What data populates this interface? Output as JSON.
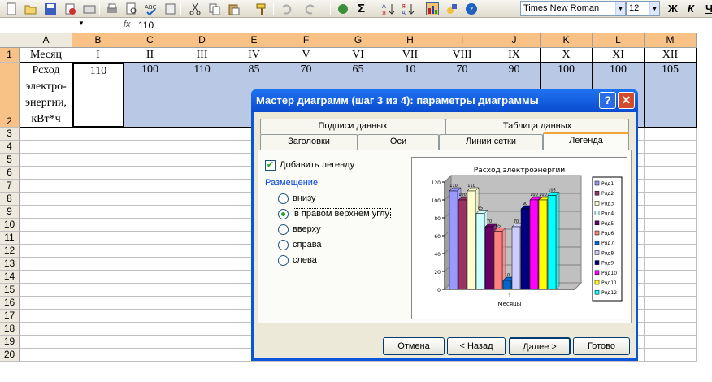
{
  "toolbar": {
    "font": "Times New Roman",
    "size": "12",
    "bold": "Ж",
    "italic": "К",
    "underline": "Ч"
  },
  "formula": {
    "ref": "",
    "fx": "fx",
    "value": "110"
  },
  "columns": [
    "A",
    "B",
    "C",
    "D",
    "E",
    "F",
    "G",
    "H",
    "I",
    "J",
    "K",
    "L",
    "M"
  ],
  "rows": [
    "1",
    "2",
    "3",
    "4",
    "5",
    "6",
    "7",
    "8",
    "9",
    "10",
    "11",
    "12",
    "13",
    "14",
    "15",
    "16",
    "17",
    "18",
    "19",
    "20"
  ],
  "row1": [
    "Месяц",
    "I",
    "II",
    "III",
    "IV",
    "V",
    "VI",
    "VII",
    "VIII",
    "IX",
    "X",
    "XI",
    "XII"
  ],
  "row2_label": [
    "Рсход",
    "электро-",
    "энергии,",
    "кВт*ч"
  ],
  "row2": [
    "110",
    "100",
    "110",
    "85",
    "70",
    "65",
    "10",
    "70",
    "90",
    "100",
    "100",
    "105"
  ],
  "dialog": {
    "title": "Мастер диаграмм (шаг 3 из 4): параметры диаграммы",
    "help": "?",
    "close": "✕",
    "tabs_back": [
      "Подписи данных",
      "Таблица данных"
    ],
    "tabs_front": [
      "Заголовки",
      "Оси",
      "Линии сетки",
      "Легенда"
    ],
    "add_legend": "Добавить легенду",
    "placement": "Размещение",
    "options": [
      "внизу",
      "в правом верхнем углу",
      "вверху",
      "справа",
      "слева"
    ],
    "buttons": [
      "Отмена",
      "< Назад",
      "Далее >",
      "Готово"
    ]
  },
  "chart_data": {
    "type": "bar",
    "title": "Расход электроэнергии",
    "xlabel": "Месяцы",
    "categories": [
      "1"
    ],
    "ylim": [
      0,
      120
    ],
    "yticks": [
      "0",
      "20",
      "40",
      "60",
      "80",
      "100",
      "120"
    ],
    "series": [
      {
        "name": "Ряд1",
        "values": [
          110
        ],
        "color": "#9999ff"
      },
      {
        "name": "Ряд2",
        "values": [
          100
        ],
        "color": "#993366"
      },
      {
        "name": "Ряд3",
        "values": [
          110
        ],
        "color": "#ffffcc"
      },
      {
        "name": "Ряд4",
        "values": [
          85
        ],
        "color": "#ccffff"
      },
      {
        "name": "Ряд5",
        "values": [
          70
        ],
        "color": "#660066"
      },
      {
        "name": "Ряд6",
        "values": [
          65
        ],
        "color": "#ff8080"
      },
      {
        "name": "Ряд7",
        "values": [
          10
        ],
        "color": "#0066cc"
      },
      {
        "name": "Ряд8",
        "values": [
          70
        ],
        "color": "#ccccff"
      },
      {
        "name": "Ряд9",
        "values": [
          90
        ],
        "color": "#000080"
      },
      {
        "name": "Ряд10",
        "values": [
          100
        ],
        "color": "#ff00ff"
      },
      {
        "name": "Ряд11",
        "values": [
          100
        ],
        "color": "#ffff00"
      },
      {
        "name": "Ряд12",
        "values": [
          105
        ],
        "color": "#00ffff"
      }
    ],
    "data_labels": [
      "110",
      "100",
      "110",
      "85",
      "70",
      "65",
      "10",
      "70",
      "90",
      "100",
      "100",
      "105"
    ],
    "legend_position": "right"
  }
}
